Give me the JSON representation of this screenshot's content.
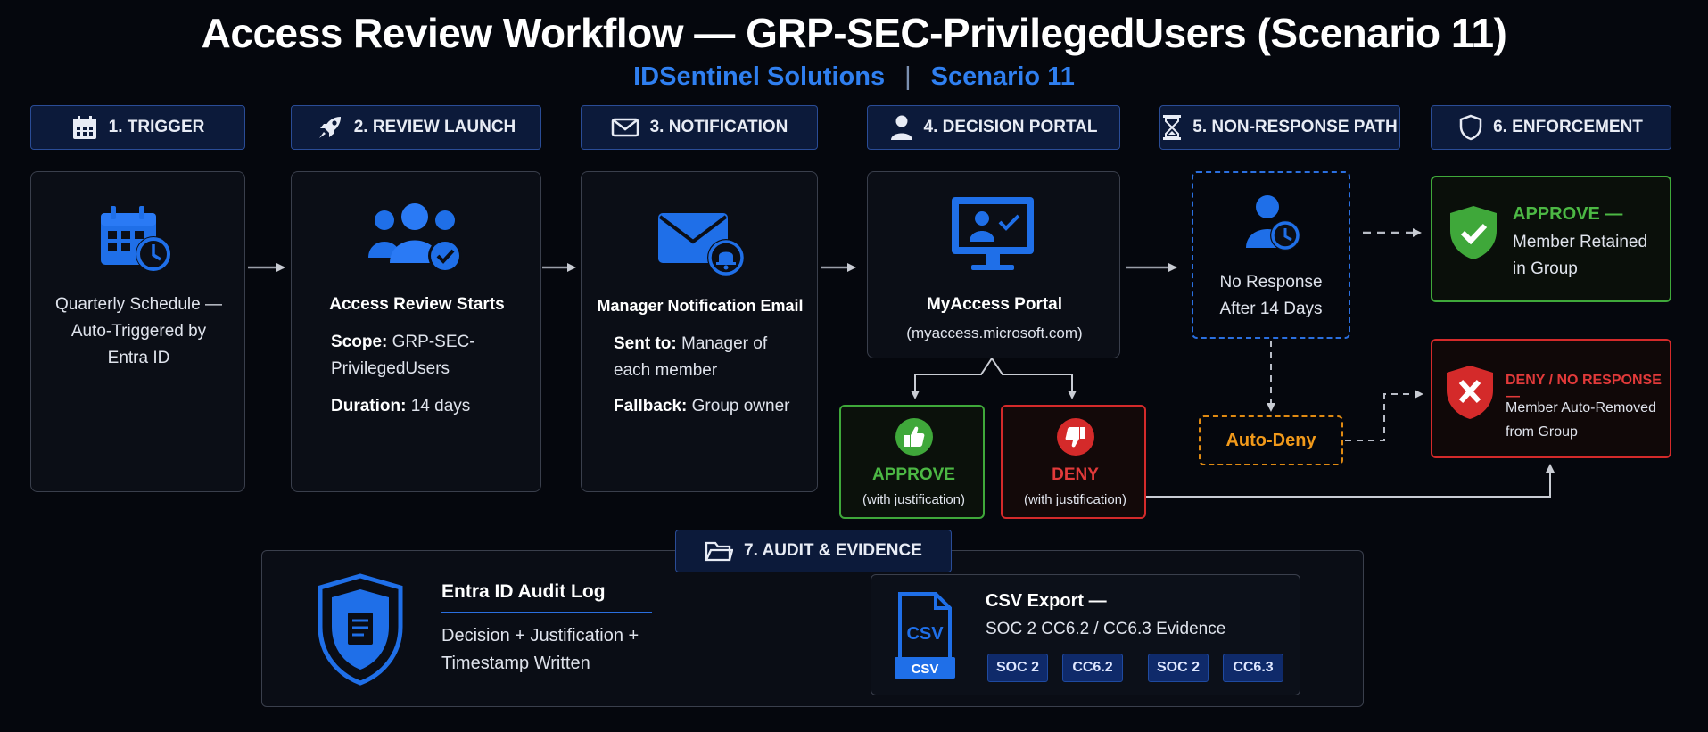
{
  "title": "Access Review Workflow — GRP-SEC-PrivilegedUsers (Scenario 11)",
  "subtitle": {
    "company": "IDSentinel Solutions",
    "separator": "|",
    "scenario": "Scenario 11"
  },
  "colors": {
    "accent_blue": "#2f7ff0",
    "approve_green": "#3fa83a",
    "deny_red": "#d42a2a",
    "autodeny_orange": "#e08a12"
  },
  "steps": [
    {
      "label": "1. TRIGGER",
      "icon": "calendar-icon"
    },
    {
      "label": "2. REVIEW LAUNCH",
      "icon": "rocket-icon"
    },
    {
      "label": "3. NOTIFICATION",
      "icon": "envelope-icon"
    },
    {
      "label": "4. DECISION PORTAL",
      "icon": "user-icon"
    },
    {
      "label": "5. NON-RESPONSE PATH",
      "icon": "hourglass-icon"
    },
    {
      "label": "6. ENFORCEMENT",
      "icon": "shield-icon"
    }
  ],
  "trigger": {
    "line1": "Quarterly Schedule —",
    "line2": "Auto-Triggered by",
    "line3": "Entra ID"
  },
  "launch": {
    "heading": "Access Review Starts",
    "scope_label": "Scope:",
    "scope_value1": "GRP-SEC-",
    "scope_value2": "PrivilegedUsers",
    "duration_label": "Duration:",
    "duration_value": "14 days"
  },
  "notification": {
    "heading": "Manager Notification Email",
    "sent_label": "Sent to:",
    "sent_value1": "Manager of",
    "sent_value2": "each member",
    "fallback_label": "Fallback:",
    "fallback_value": "Group owner"
  },
  "portal": {
    "heading": "MyAccess Portal",
    "url": "(myaccess.microsoft.com)"
  },
  "approve": {
    "label": "APPROVE",
    "note": "(with justification)"
  },
  "deny": {
    "label": "DENY",
    "note": "(with justification)"
  },
  "nonresponse": {
    "line1": "No Response",
    "line2": "After 14 Days",
    "autodeny": "Auto-Deny"
  },
  "enforce_approve": {
    "label": "APPROVE —",
    "line1": "Member Retained",
    "line2": "in Group"
  },
  "enforce_deny": {
    "label": "DENY / NO RESPONSE —",
    "line1": "Member Auto-Removed",
    "line2": "from Group"
  },
  "audit": {
    "header": "7. AUDIT & EVIDENCE",
    "log_title": "Entra ID Audit Log",
    "log_line1": "Decision + Justification +",
    "log_line2": "Timestamp Written",
    "csv_icon_text": "CSV",
    "csv_badge": "CSV",
    "export_title": "CSV Export —",
    "export_line": "SOC 2 CC6.2 / CC6.3 Evidence",
    "tags": [
      "SOC 2",
      "CC6.2",
      "SOC 2",
      "CC6.3"
    ]
  }
}
